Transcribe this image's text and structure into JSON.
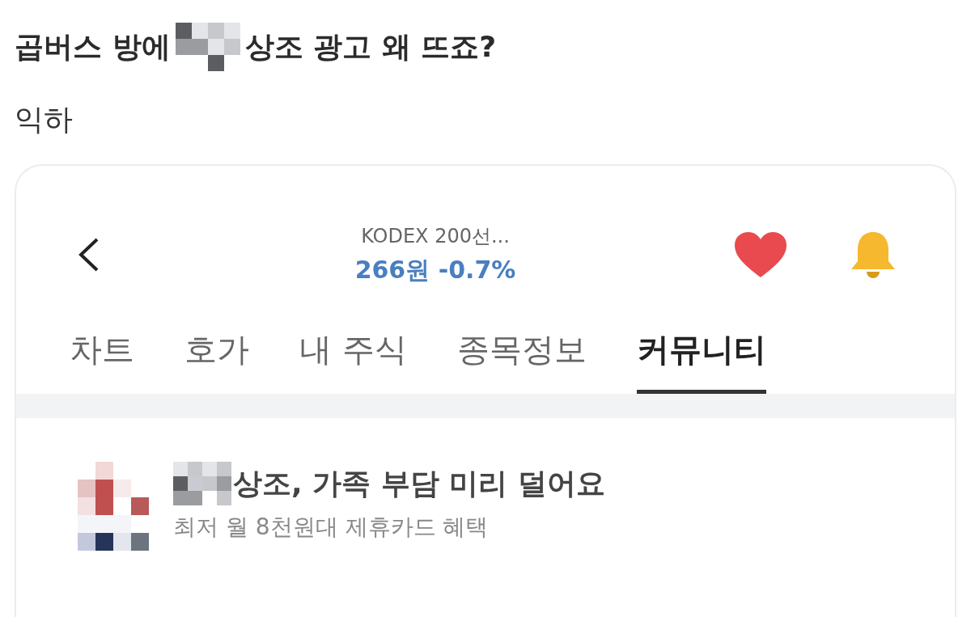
{
  "post": {
    "title_start": "곱버스 방에",
    "title_end": "상조 광고 왜 뜨죠?",
    "body": "익하"
  },
  "app": {
    "stock_name": "KODEX 200선...",
    "price": "266원 -0.7%",
    "favorite": true,
    "tabs": [
      {
        "label": "차트",
        "selected": false
      },
      {
        "label": "호가",
        "selected": false
      },
      {
        "label": "내 주식",
        "selected": false
      },
      {
        "label": "종목정보",
        "selected": false
      },
      {
        "label": "커뮤니티",
        "selected": true
      }
    ],
    "ad": {
      "title": "상조, 가족 부담 미리 덜어요",
      "subtitle": "최저 월 8천원대 제휴카드 혜택"
    }
  }
}
